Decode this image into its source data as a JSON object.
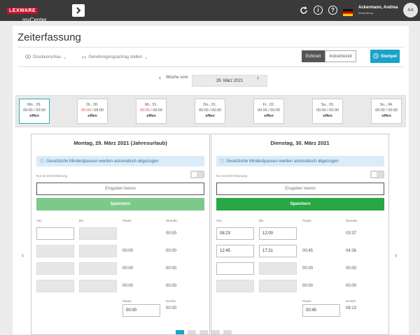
{
  "topbar": {
    "logo_brand": "LEXWARE",
    "logo_product": "myCenter",
    "nav_arrow": "chevron-right-icon",
    "user_name": "Ackermann, Andrea",
    "user_company": "Musterfirma",
    "avatar_initials": "AA",
    "colors": {
      "bar": "#3a3a3a",
      "brand_red": "#c8102e"
    }
  },
  "page": {
    "title": "Zeiterfassung",
    "toolbar": {
      "print_preview": "Druckvorschau",
      "approval_request": "Genehmigungsantrag stellen",
      "mode_realtime": "Echtzeit",
      "mode_industrial": "Industriezeit",
      "stamp": "Stempel"
    },
    "week": {
      "label": "Woche vom",
      "value": "29. März 2021"
    },
    "days": [
      {
        "header": "Mo., 29.",
        "time_a": "00:00",
        "time_b": "00:00",
        "status": "offen",
        "active": true
      },
      {
        "header": "Di., 30.",
        "time_a": "00:00",
        "time_b": "08:00",
        "status": "offen",
        "active": false
      },
      {
        "header": "Mi., 31.",
        "time_a": "00:00",
        "time_b": "08:00",
        "status": "offen",
        "active": false
      },
      {
        "header": "Do., 01.",
        "time_a": "00:00",
        "time_b": "00:00",
        "status": "offen",
        "active": false
      },
      {
        "header": "Fr., 02.",
        "time_a": "00:00",
        "time_b": "00:00",
        "status": "offen",
        "active": false
      },
      {
        "header": "Sa., 03.",
        "time_a": "00:00",
        "time_b": "00:00",
        "status": "offen",
        "active": false
      },
      {
        "header": "So., 04.",
        "time_a": "00:00",
        "time_b": "00:00",
        "status": "offen",
        "active": false
      }
    ],
    "time_separator": "/",
    "panels": [
      {
        "title": "Montag, 29. März 2021 (Jahresurlaub)",
        "info": "Gesetzliche Mindestpausen werden automatisch abgezogen",
        "toggle_label": "Nur Ist-Zeit-Erfassung",
        "clear_label": "Eingaben leeren",
        "save_label": "Speichern",
        "col_from": "Von",
        "col_to": "Bis",
        "col_pause": "Pause",
        "col_hours": "Stunden",
        "rows": [
          {
            "from": "",
            "to": "",
            "pause": "",
            "hours": "00:00"
          },
          {
            "from": "",
            "to": "",
            "pause": "00:00",
            "hours": "00:00"
          },
          {
            "from": "",
            "to": "",
            "pause": "00:00",
            "hours": "00:00"
          },
          {
            "from": "",
            "to": "",
            "pause": "00:00",
            "hours": "00:00"
          }
        ],
        "total_pause_label": "Pause",
        "total_pause": "00:00",
        "ist_label": "Ist-Zeit",
        "ist_value": "00:00",
        "save_color": "#7cc98a"
      },
      {
        "title": "Dienstag, 30. März 2021",
        "info": "Gesetzliche Mindestpausen werden automatisch abgezogen",
        "toggle_label": "Nur Ist-Zeit-Erfassung",
        "clear_label": "Eingaben leeren",
        "save_label": "Speichern",
        "col_from": "Von",
        "col_to": "Bis",
        "col_pause": "Pause",
        "col_hours": "Stunden",
        "rows": [
          {
            "from": "08:23",
            "to": "12:00",
            "pause": "",
            "hours": "03:37"
          },
          {
            "from": "12:45",
            "to": "17:21",
            "pause": "00:45",
            "hours": "04:36"
          },
          {
            "from": "",
            "to": "",
            "pause": "00:00",
            "hours": "00:00"
          },
          {
            "from": "",
            "to": "",
            "pause": "00:00",
            "hours": "00:00"
          }
        ],
        "total_pause_label": "Pause",
        "total_pause": "00:45",
        "ist_label": "Ist-Zeit",
        "ist_value": "08:13",
        "save_color": "#28a745"
      }
    ]
  }
}
